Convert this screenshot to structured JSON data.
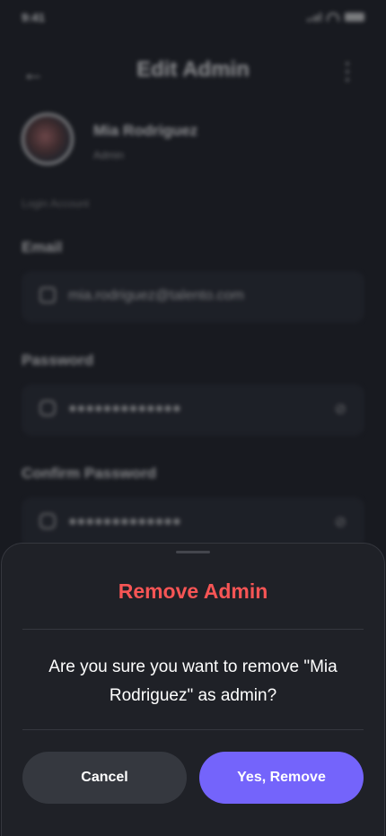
{
  "status_bar": {
    "time": "9:41"
  },
  "header": {
    "title": "Edit Admin",
    "back_icon": "arrow-left-icon",
    "more_icon": "more-vertical-icon"
  },
  "profile": {
    "name": "Mia Rodriguez",
    "role": "Admin"
  },
  "section_label": "Login Account",
  "form": {
    "email_label": "Email",
    "email_value": "mia.rodriguez@talento.com",
    "password_label": "Password",
    "password_value": "●●●●●●●●●●●●●",
    "confirm_label": "Confirm Password",
    "confirm_value": "●●●●●●●●●●●●●"
  },
  "dialog": {
    "title": "Remove Admin",
    "message": "Are you sure you want to remove \"Mia Rodriguez\" as admin?",
    "cancel_label": "Cancel",
    "confirm_label": "Yes, Remove",
    "colors": {
      "danger": "#f75555",
      "primary": "#7464fb",
      "secondary": "#35383f"
    }
  }
}
